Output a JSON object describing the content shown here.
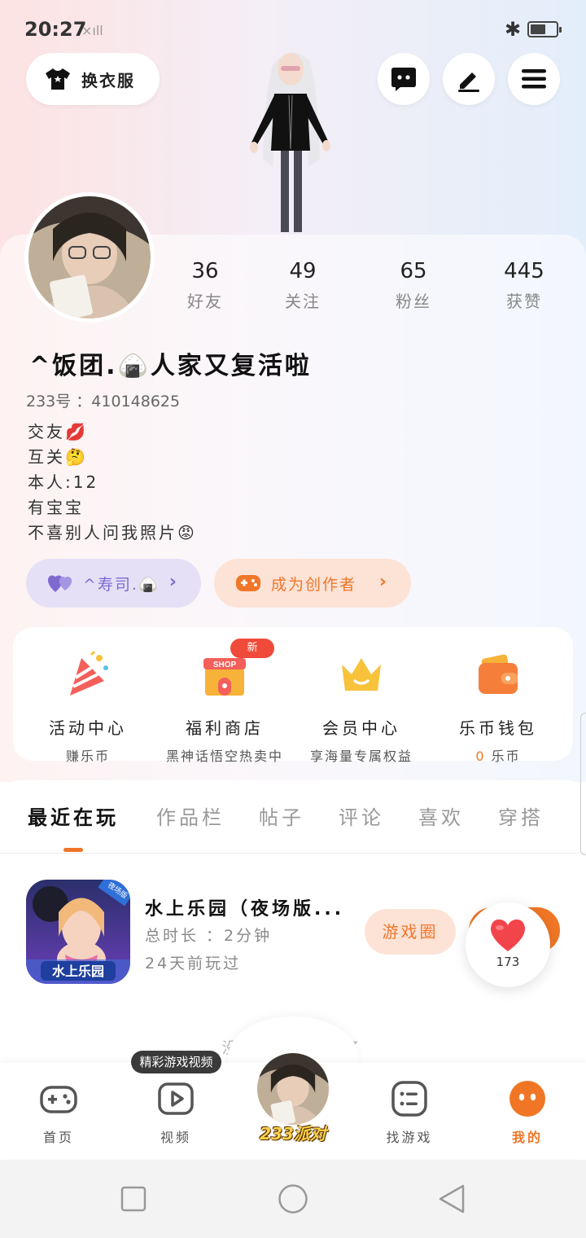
{
  "status_bar": {
    "time": "20:27",
    "signal": "×ıll"
  },
  "top_bar": {
    "outfit_label": "换衣服"
  },
  "profile": {
    "stats": [
      {
        "num": "36",
        "label": "好友"
      },
      {
        "num": "49",
        "label": "关注"
      },
      {
        "num": "65",
        "label": "粉丝"
      },
      {
        "num": "445",
        "label": "获赞"
      }
    ],
    "nickname": "^饭团.🍙人家又复活啦",
    "uid": "233号 ：410148625",
    "bio": [
      "交友💋",
      "互关🤔",
      "本人:12",
      "有宝宝",
      "不喜别人问我照片😡"
    ],
    "tag_partner": "^寿司.🍙",
    "tag_creator": "成为创作者"
  },
  "services": [
    {
      "title": "活动中心",
      "sub": "赚乐币",
      "sub_hl": ""
    },
    {
      "title": "福利商店",
      "sub": "黑神话悟空热卖中",
      "sub_hl": ""
    },
    {
      "title": "会员中心",
      "sub": "享海量专属权益",
      "sub_hl": ""
    },
    {
      "title": "乐币钱包",
      "sub": " 乐币",
      "sub_hl": "0"
    }
  ],
  "new_badge": "新",
  "shop_sign": "SHOP",
  "tabs": [
    "最近在玩",
    "作品栏",
    "帖子",
    "评论",
    "喜欢",
    "穿搭"
  ],
  "recent_game": {
    "title": "水上乐园（夜场版...",
    "duration": "总时长 ：2分钟",
    "last_played": "24天前玩过",
    "circle_button": "游戏圈",
    "icon_label": "水上乐园",
    "icon_badge": "夜场版"
  },
  "like_count": "173",
  "no_more_text": "没有更多游戏了",
  "bottom_nav": {
    "items": [
      "首页",
      "视频",
      "找游戏",
      "我的"
    ],
    "video_tooltip": "精彩游戏视频",
    "center_logo": "233派对"
  },
  "colors": {
    "accent": "#f07626",
    "purple": "#7f6bd0",
    "new_badge": "#f04b3a"
  }
}
